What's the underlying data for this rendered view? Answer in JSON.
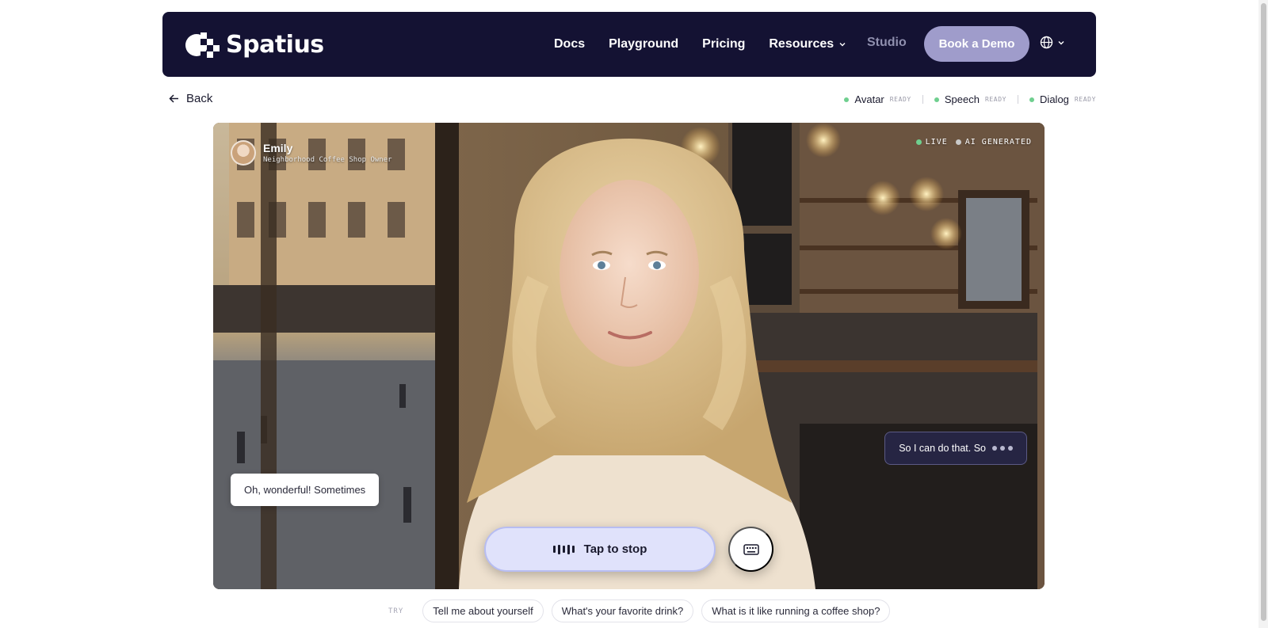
{
  "nav": {
    "brand": "Spatius",
    "links": [
      {
        "label": "Docs"
      },
      {
        "label": "Playground"
      },
      {
        "label": "Pricing"
      },
      {
        "label": "Resources"
      }
    ],
    "studio_label": "Studio",
    "demo_label": "Book a Demo"
  },
  "back_label": "Back",
  "status": [
    {
      "label": "Avatar",
      "state": "READY"
    },
    {
      "label": "Speech",
      "state": "READY"
    },
    {
      "label": "Dialog",
      "state": "READY"
    }
  ],
  "scene": {
    "persona_name": "Emily",
    "persona_role": "Neighborhood Coffee Shop Owner",
    "live_label": "LIVE",
    "ai_label": "AI GENERATED",
    "user_message": "Oh, wonderful! Sometimes",
    "ai_message": "So I can do that. So",
    "stop_label": "Tap to stop"
  },
  "suggestions": {
    "try_label": "TRY",
    "chips": [
      "Tell me about yourself",
      "What's your favorite drink?",
      "What is it like running a coffee shop?"
    ]
  },
  "colors": {
    "nav_bg": "#141233",
    "demo_button": "#9f9ccb",
    "ready_dot": "#6fcf8f",
    "stop_button": "#e0e2fb"
  }
}
